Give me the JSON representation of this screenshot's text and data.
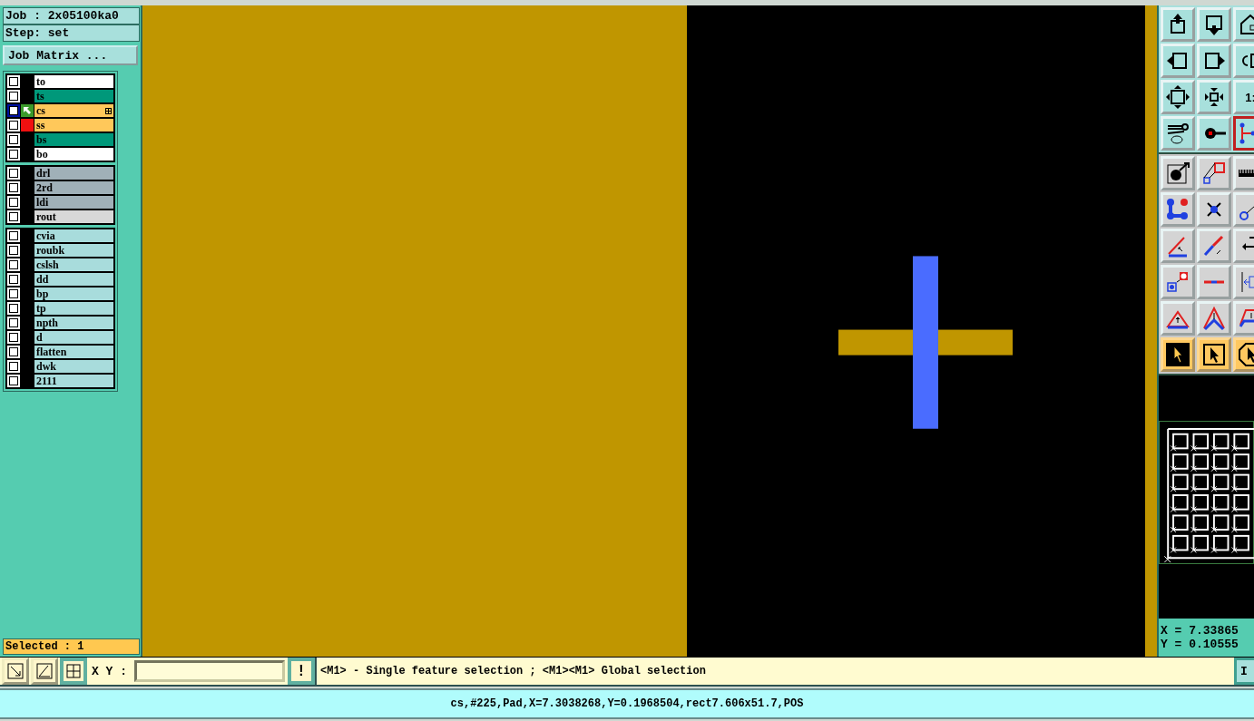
{
  "job": {
    "job_label": "Job : 2x05100ka0",
    "step_label": "Step: set",
    "matrix_button": "Job Matrix ..."
  },
  "layer_groups": [
    {
      "layers": [
        {
          "name": "to",
          "color": "#ffffff",
          "checked": false,
          "work": false,
          "shown": false
        },
        {
          "name": "ts",
          "color": "#00987a",
          "checked": false,
          "work": false,
          "shown": false
        },
        {
          "name": "cs",
          "color": "#ffc85a",
          "checked": false,
          "work": true,
          "shown": false
        },
        {
          "name": "ss",
          "color": "#ffc85a",
          "checked": false,
          "work": false,
          "shown": true
        },
        {
          "name": "bs",
          "color": "#00987a",
          "checked": false,
          "work": false,
          "shown": false
        },
        {
          "name": "bo",
          "color": "#ffffff",
          "checked": false,
          "work": false,
          "shown": false
        }
      ]
    },
    {
      "layers": [
        {
          "name": "drl",
          "color": "#a0b0b8",
          "checked": false,
          "work": false,
          "shown": false
        },
        {
          "name": "2rd",
          "color": "#a0b0b8",
          "checked": false,
          "work": false,
          "shown": false
        },
        {
          "name": "ldi",
          "color": "#a0b0b8",
          "checked": false,
          "work": false,
          "shown": false
        },
        {
          "name": "rout",
          "color": "#d8d8d8",
          "checked": false,
          "work": false,
          "shown": false
        }
      ]
    },
    {
      "layers": [
        {
          "name": "cvia",
          "color": "#a8dcdc",
          "checked": false,
          "work": false,
          "shown": false
        },
        {
          "name": "roubk",
          "color": "#a8dcdc",
          "checked": false,
          "work": false,
          "shown": false
        },
        {
          "name": "cslsh",
          "color": "#a8dcdc",
          "checked": false,
          "work": false,
          "shown": false
        },
        {
          "name": "dd",
          "color": "#a8dcdc",
          "checked": false,
          "work": false,
          "shown": false
        },
        {
          "name": "bp",
          "color": "#a8dcdc",
          "checked": false,
          "work": false,
          "shown": false
        },
        {
          "name": "tp",
          "color": "#a8dcdc",
          "checked": false,
          "work": false,
          "shown": false
        },
        {
          "name": "npth",
          "color": "#a8dcdc",
          "checked": false,
          "work": false,
          "shown": false
        },
        {
          "name": "d",
          "color": "#a8dcdc",
          "checked": false,
          "work": false,
          "shown": false
        },
        {
          "name": "flatten",
          "color": "#a8dcdc",
          "checked": false,
          "work": false,
          "shown": false
        },
        {
          "name": "dwk",
          "color": "#a8dcdc",
          "checked": false,
          "work": false,
          "shown": false
        },
        {
          "name": "2111",
          "color": "#a8dcdc",
          "checked": false,
          "work": false,
          "shown": false
        }
      ]
    }
  ],
  "selected_count": "Selected : 1",
  "toolbar": [
    {
      "on": false,
      "active": false
    },
    {
      "on": false,
      "active": false
    },
    {
      "on": false,
      "active": false
    },
    {
      "on": false,
      "active": false
    },
    {
      "on": false,
      "active": false
    },
    {
      "on": false,
      "active": false
    },
    {
      "on": false,
      "active": false
    },
    {
      "on": false,
      "active": false
    },
    {
      "on": false,
      "active": false,
      "label": "1:"
    },
    {
      "on": false,
      "active": false
    },
    {
      "on": false,
      "active": false
    },
    {
      "on": true,
      "active": false
    },
    {
      "on": false,
      "active": false
    },
    {
      "on": false,
      "active": false
    },
    {
      "on": false,
      "active": false
    },
    {
      "on": false,
      "active": false
    },
    {
      "on": false,
      "active": false
    },
    {
      "on": false,
      "active": false
    },
    {
      "on": false,
      "active": false
    },
    {
      "on": false,
      "active": false
    },
    {
      "on": false,
      "active": false
    },
    {
      "on": false,
      "active": false
    },
    {
      "on": false,
      "active": false
    },
    {
      "on": false,
      "active": false
    },
    {
      "on": false,
      "active": false
    },
    {
      "on": false,
      "active": false
    },
    {
      "on": false,
      "active": false
    },
    {
      "on": false,
      "active": true
    },
    {
      "on": false,
      "active": true
    },
    {
      "on": false,
      "active": true
    }
  ],
  "coordinates": {
    "x": "X = 7.33865",
    "y": "Y = 0.10555"
  },
  "command_bar": {
    "buttons": [
      {
        "pressed": false
      },
      {
        "pressed": false
      },
      {
        "pressed": true
      }
    ],
    "xy_label": "X Y :",
    "warning_button": "!",
    "message": "<M1> - Single feature selection ; <M1><M1> Global selection",
    "right_button": "I"
  },
  "status_line": "cs,#225,Pad,X=7.3038268,Y=0.1968504,rect7.606x51.7,POS"
}
